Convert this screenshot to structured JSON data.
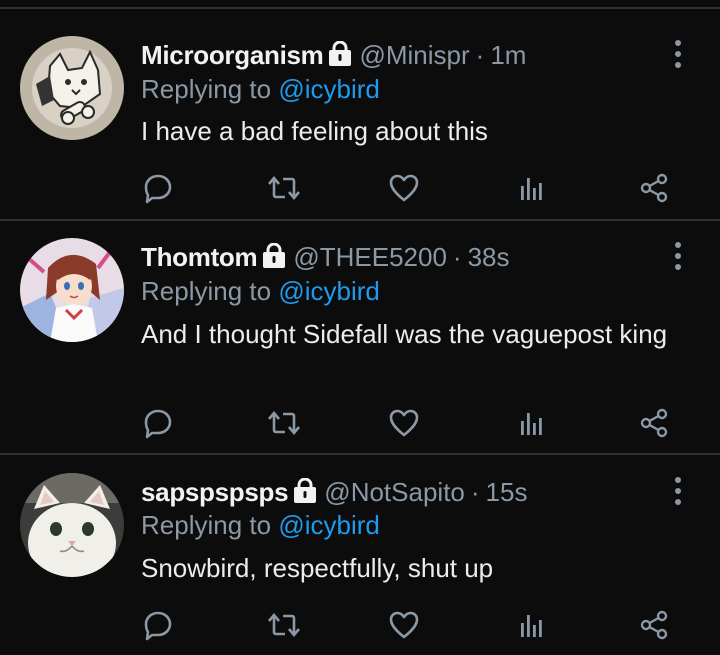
{
  "colors": {
    "background": "#0c0c0c",
    "name": "#f2f2f2",
    "muted": "#8b98a5",
    "mention": "#1d9bf0",
    "divider": "#2f3336"
  },
  "tweets": [
    {
      "name": "Microorganism",
      "handle": "@Minispr",
      "separator": "·",
      "time": "1m",
      "reply_prefix": "Replying to ",
      "reply_to": "@icybird",
      "text": "I have a bad feeling about this",
      "avatar": "cat-skull-drawing"
    },
    {
      "name": "Thomtom",
      "handle": "@THEE5200",
      "separator": "·",
      "time": "38s",
      "reply_prefix": "Replying to ",
      "reply_to": "@icybird",
      "text": "And I thought Sidefall was the vaguepost king",
      "avatar": "anime-character"
    },
    {
      "name": "sapspspsps",
      "handle": "@NotSapito",
      "separator": "·",
      "time": "15s",
      "reply_prefix": "Replying to ",
      "reply_to": "@icybird",
      "text": "Snowbird, respectfully, shut up",
      "avatar": "white-cat-photo"
    }
  ],
  "icons": [
    "lock-icon",
    "more-icon",
    "reply-icon",
    "retweet-icon",
    "like-icon",
    "analytics-icon",
    "share-icon"
  ]
}
